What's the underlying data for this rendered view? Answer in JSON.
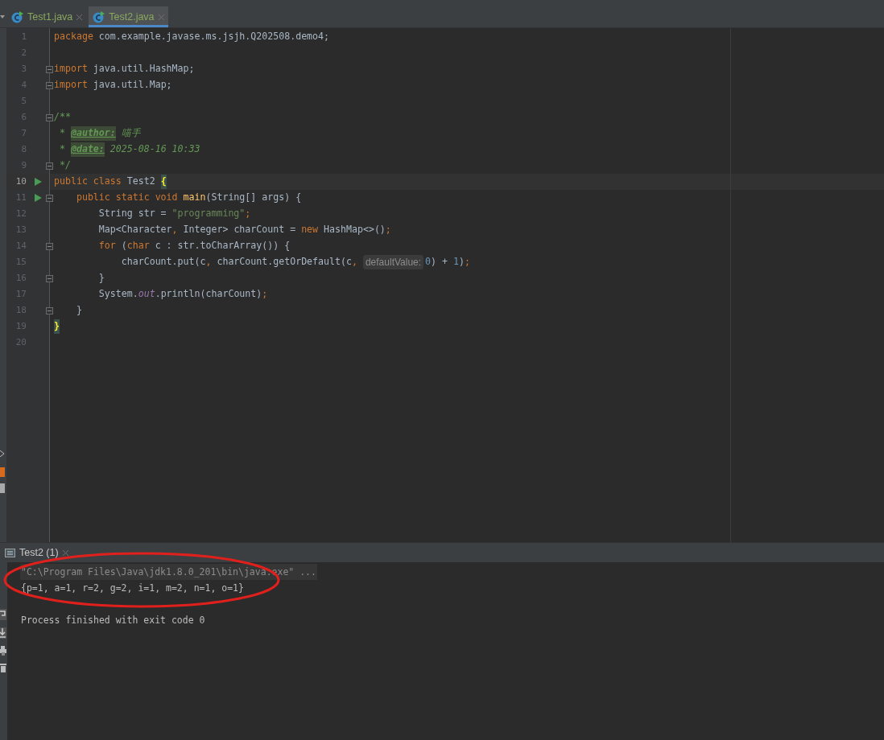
{
  "tabs": [
    {
      "label": "Test1.java",
      "selected": false
    },
    {
      "label": "Test2.java",
      "selected": true
    }
  ],
  "editor": {
    "lines": [
      {
        "number": "1",
        "run_marker": false,
        "fold_marker": false,
        "current": false,
        "tokens": [
          {
            "kind": "keyword",
            "text": "package"
          },
          {
            "kind": "plain",
            "text": " com.example.javase.ms.jsjh.Q202508.demo4;"
          }
        ]
      },
      {
        "number": "2",
        "run_marker": false,
        "fold_marker": false,
        "current": false
      },
      {
        "number": "3",
        "run_marker": false,
        "fold_marker": true,
        "current": false,
        "tokens": [
          {
            "kind": "keyword",
            "text": "import"
          },
          {
            "kind": "plain",
            "text": " java.util.HashMap;"
          }
        ]
      },
      {
        "number": "4",
        "run_marker": false,
        "fold_marker": true,
        "current": false,
        "tokens": [
          {
            "kind": "keyword",
            "text": "import"
          },
          {
            "kind": "plain",
            "text": " java.util.Map;"
          }
        ]
      },
      {
        "number": "5",
        "run_marker": false,
        "fold_marker": false,
        "current": false
      },
      {
        "number": "6",
        "run_marker": false,
        "fold_marker": true,
        "current": false,
        "tokens": [
          {
            "kind": "doc",
            "text": "/**"
          }
        ]
      },
      {
        "number": "7",
        "run_marker": false,
        "fold_marker": false,
        "current": false,
        "tokens": [
          {
            "kind": "doc",
            "text": " * "
          },
          {
            "kind": "doc_tag",
            "text": "@author:"
          },
          {
            "kind": "doc",
            "text": " 喵手"
          }
        ]
      },
      {
        "number": "8",
        "run_marker": false,
        "fold_marker": false,
        "current": false,
        "tokens": [
          {
            "kind": "doc",
            "text": " * "
          },
          {
            "kind": "doc_tag",
            "text": "@date:"
          },
          {
            "kind": "doc",
            "text": " 2025-08-16 10:33"
          }
        ]
      },
      {
        "number": "9",
        "run_marker": false,
        "fold_marker": true,
        "current": false,
        "tokens": [
          {
            "kind": "doc",
            "text": " */"
          }
        ]
      },
      {
        "number": "10",
        "run_marker": true,
        "fold_marker": false,
        "current": true,
        "tokens": [
          {
            "kind": "keyword",
            "text": "public class"
          },
          {
            "kind": "plain",
            "text": " Test2 "
          },
          {
            "kind": "brace_match",
            "text": "{"
          }
        ]
      },
      {
        "number": "11",
        "run_marker": true,
        "fold_marker": true,
        "current": false,
        "tokens": [
          {
            "kind": "keyword",
            "text": "    public static void "
          },
          {
            "kind": "method",
            "text": "main"
          },
          {
            "kind": "plain",
            "text": "(String[] args) {"
          }
        ]
      },
      {
        "number": "12",
        "run_marker": false,
        "fold_marker": false,
        "current": false,
        "tokens": [
          {
            "kind": "plain",
            "text": "        String str = "
          },
          {
            "kind": "string",
            "text": "\"programming\""
          },
          {
            "kind": "keyword",
            "text": ";"
          }
        ]
      },
      {
        "number": "13",
        "run_marker": false,
        "fold_marker": false,
        "current": false,
        "tokens": [
          {
            "kind": "plain",
            "text": "        Map<Character"
          },
          {
            "kind": "keyword",
            "text": ","
          },
          {
            "kind": "plain",
            "text": " Integer> charCount = "
          },
          {
            "kind": "keyword",
            "text": "new"
          },
          {
            "kind": "plain",
            "text": " HashMap<>()"
          },
          {
            "kind": "keyword",
            "text": ";"
          }
        ]
      },
      {
        "number": "14",
        "run_marker": false,
        "fold_marker": true,
        "current": false,
        "tokens": [
          {
            "kind": "keyword",
            "text": "        for"
          },
          {
            "kind": "plain",
            "text": " ("
          },
          {
            "kind": "keyword",
            "text": "char"
          },
          {
            "kind": "plain",
            "text": " c : str.toCharArray()) {"
          }
        ]
      },
      {
        "number": "15",
        "run_marker": false,
        "fold_marker": false,
        "current": false,
        "tokens": [
          {
            "kind": "plain",
            "text": "            charCount.put(c"
          },
          {
            "kind": "keyword",
            "text": ","
          },
          {
            "kind": "plain",
            "text": " charCount.getOrDefault(c"
          },
          {
            "kind": "keyword",
            "text": ", "
          },
          {
            "kind": "hint",
            "text": "defaultValue:"
          },
          {
            "kind": "number",
            "text": "0"
          },
          {
            "kind": "plain",
            "text": ") + "
          },
          {
            "kind": "number",
            "text": "1"
          },
          {
            "kind": "plain",
            "text": ")"
          },
          {
            "kind": "keyword",
            "text": ";"
          }
        ]
      },
      {
        "number": "16",
        "run_marker": false,
        "fold_marker": true,
        "current": false,
        "tokens": [
          {
            "kind": "plain",
            "text": "        }"
          }
        ]
      },
      {
        "number": "17",
        "run_marker": false,
        "fold_marker": false,
        "current": false,
        "tokens": [
          {
            "kind": "plain",
            "text": "        System."
          },
          {
            "kind": "static_field",
            "text": "out"
          },
          {
            "kind": "plain",
            "text": ".println(charCount)"
          },
          {
            "kind": "keyword",
            "text": ";"
          }
        ]
      },
      {
        "number": "18",
        "run_marker": false,
        "fold_marker": true,
        "current": false,
        "tokens": [
          {
            "kind": "plain",
            "text": "    }"
          }
        ]
      },
      {
        "number": "19",
        "run_marker": false,
        "fold_marker": false,
        "current": false,
        "tokens": [
          {
            "kind": "brace_match",
            "text": "}"
          }
        ]
      },
      {
        "number": "20",
        "run_marker": false,
        "fold_marker": false,
        "current": false
      }
    ]
  },
  "run_panel": {
    "tab": {
      "label": "Test2 (1)",
      "selected": true
    },
    "lines": [
      {
        "kind": "command",
        "text": "\"C:\\Program Files\\Java\\jdk1.8.0_201\\bin\\java.exe\" ..."
      },
      {
        "kind": "output",
        "text": "{p=1, a=1, r=2, g=2, i=1, m=2, n=1, o=1}"
      },
      {
        "kind": "status",
        "text": "Process finished with exit code 0"
      }
    ],
    "annotation": {
      "kind": "ellipse",
      "color": "#e0201c"
    }
  }
}
